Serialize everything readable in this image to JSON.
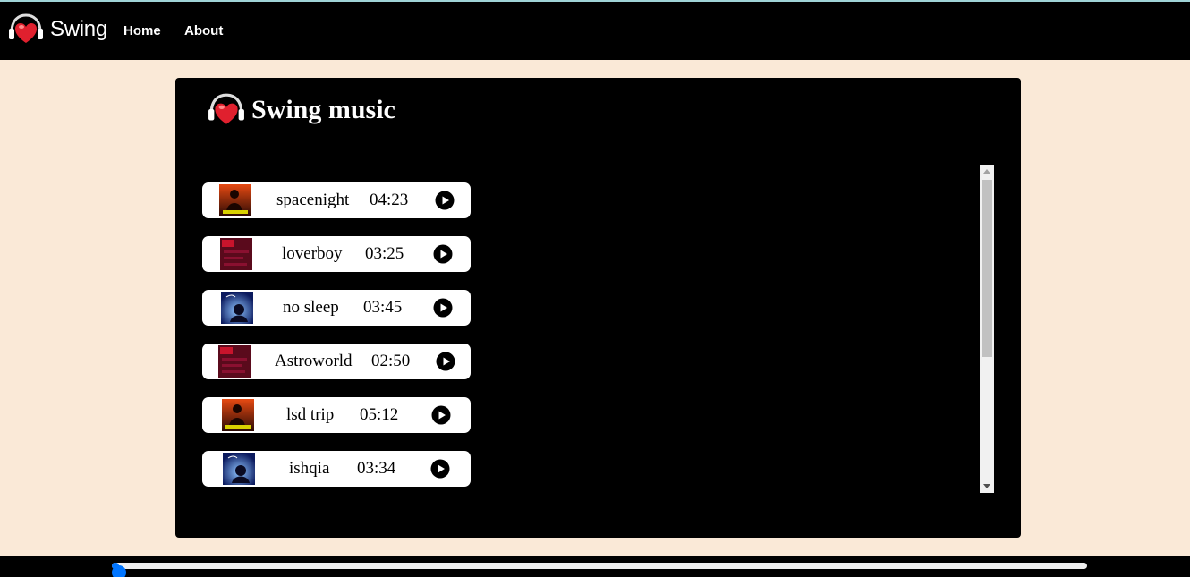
{
  "nav": {
    "brand": "Swing",
    "links": [
      "Home",
      "About"
    ]
  },
  "panel": {
    "title": "Swing music"
  },
  "tracks": [
    {
      "name": "spacenight",
      "duration": "04:23",
      "cover": "sunset-silhouette"
    },
    {
      "name": "loverboy",
      "duration": "03:25",
      "cover": "crimson-text"
    },
    {
      "name": "no sleep",
      "duration": "03:45",
      "cover": "blue-night"
    },
    {
      "name": "Astroworld",
      "duration": "02:50",
      "cover": "crimson-text"
    },
    {
      "name": "lsd trip",
      "duration": "05:12",
      "cover": "sunset-silhouette"
    },
    {
      "name": "ishqia",
      "duration": "03:34",
      "cover": "blue-night"
    }
  ],
  "player": {
    "progress": 0.0
  },
  "icons": {
    "logo": "heart-headphones-icon",
    "play": "play-icon"
  },
  "colors": {
    "background": "#fae9d7",
    "navbar": "#000000",
    "accent": "#0075ff"
  }
}
